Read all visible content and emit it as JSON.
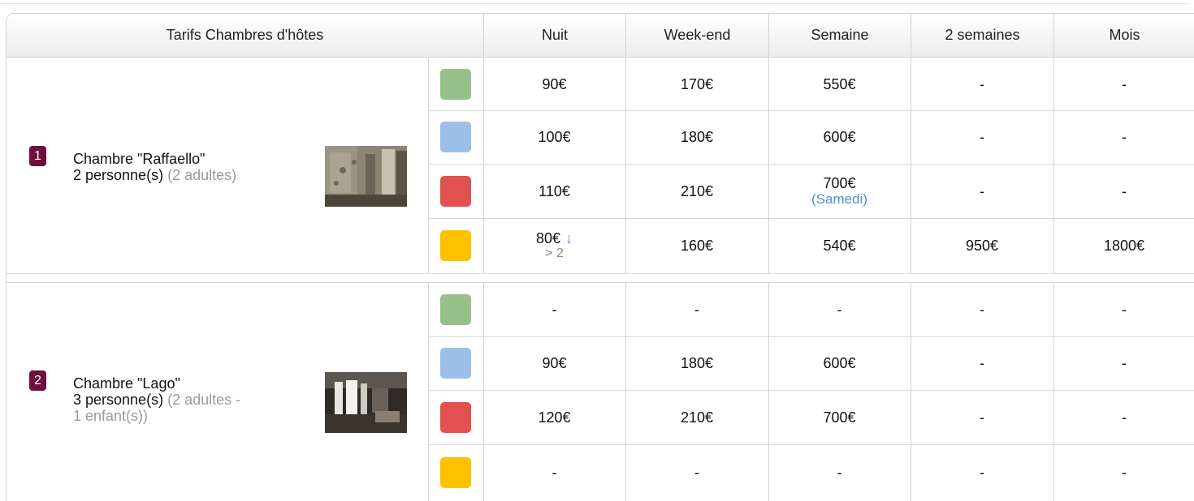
{
  "table": {
    "header": {
      "title": "Tarifs Chambres d'hôtes",
      "columns": [
        "Nuit",
        "Week-end",
        "Semaine",
        "2 semaines",
        "Mois"
      ]
    },
    "season_colors": [
      "#98c08a",
      "#9bbfe9",
      "#e05252",
      "#fdc100"
    ],
    "rooms": [
      {
        "number": "1",
        "name": "Chambre \"Raffaello\"",
        "capacity": "2 personne(s)",
        "detail": "(2 adultes)",
        "detail_line2": "",
        "rows": [
          {
            "color": "#98c08a",
            "nuit": "90€",
            "nuit_arrow": "",
            "nuit_sub": "",
            "weekend": "170€",
            "semaine": "550€",
            "semaine_note": "",
            "deux_semaines": "-",
            "mois": "-"
          },
          {
            "color": "#9bbfe9",
            "nuit": "100€",
            "nuit_arrow": "",
            "nuit_sub": "",
            "weekend": "180€",
            "semaine": "600€",
            "semaine_note": "",
            "deux_semaines": "-",
            "mois": "-"
          },
          {
            "color": "#e05252",
            "nuit": "110€",
            "nuit_arrow": "",
            "nuit_sub": "",
            "weekend": "210€",
            "semaine": "700€",
            "semaine_note": "(Samedi)",
            "deux_semaines": "-",
            "mois": "-"
          },
          {
            "color": "#fdc100",
            "nuit": "80€",
            "nuit_arrow": "↓",
            "nuit_sub": "> 2",
            "weekend": "160€",
            "semaine": "540€",
            "semaine_note": "",
            "deux_semaines": "950€",
            "mois": "1800€"
          }
        ]
      },
      {
        "number": "2",
        "name": "Chambre \"Lago\"",
        "capacity": "3 personne(s)",
        "detail": "(2 adultes -",
        "detail_line2": "1 enfant(s))",
        "rows": [
          {
            "color": "#98c08a",
            "nuit": "-",
            "nuit_arrow": "",
            "nuit_sub": "",
            "weekend": "-",
            "semaine": "-",
            "semaine_note": "",
            "deux_semaines": "-",
            "mois": "-"
          },
          {
            "color": "#9bbfe9",
            "nuit": "90€",
            "nuit_arrow": "",
            "nuit_sub": "",
            "weekend": "180€",
            "semaine": "600€",
            "semaine_note": "",
            "deux_semaines": "-",
            "mois": "-"
          },
          {
            "color": "#e05252",
            "nuit": "120€",
            "nuit_arrow": "",
            "nuit_sub": "",
            "weekend": "210€",
            "semaine": "700€",
            "semaine_note": "",
            "deux_semaines": "-",
            "mois": "-"
          },
          {
            "color": "#fdc100",
            "nuit": "-",
            "nuit_arrow": "",
            "nuit_sub": "",
            "weekend": "-",
            "semaine": "-",
            "semaine_note": "",
            "deux_semaines": "-",
            "mois": "-"
          }
        ]
      }
    ]
  }
}
